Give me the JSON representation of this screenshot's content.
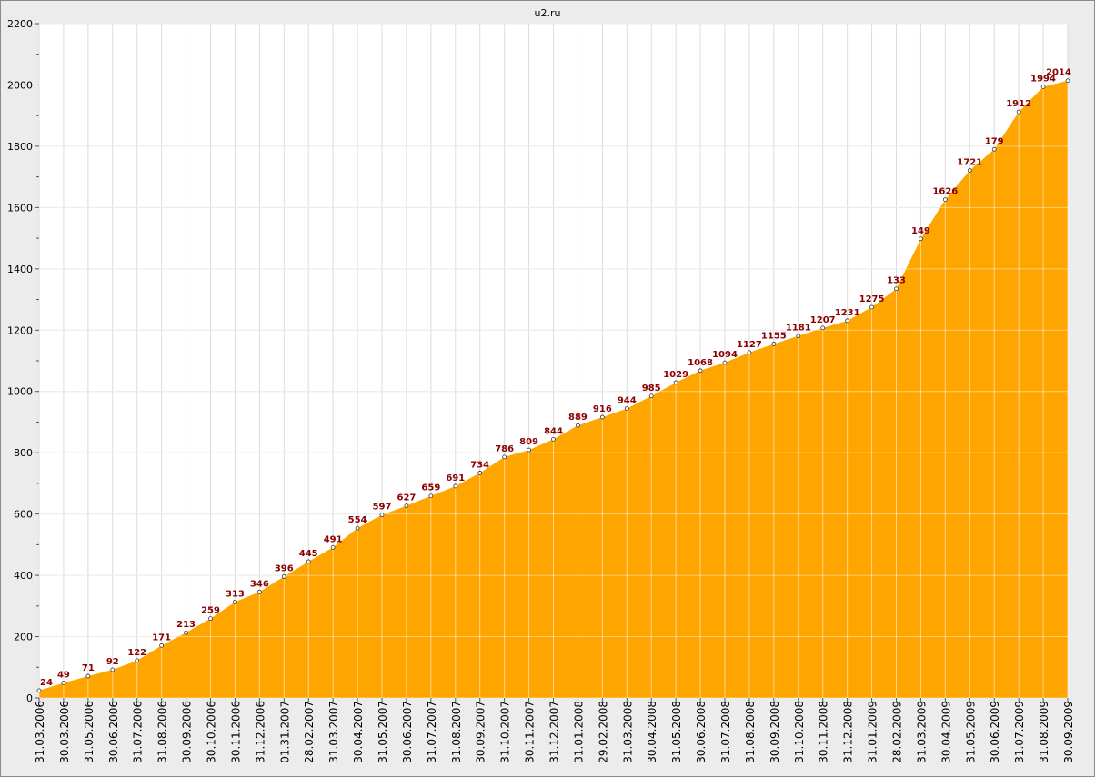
{
  "chart_data": {
    "type": "area",
    "title": "u2.ru",
    "xlabel": "",
    "ylabel": "",
    "ylim": [
      0,
      2200
    ],
    "yticks": [
      0,
      200,
      400,
      600,
      800,
      1000,
      1200,
      1400,
      1600,
      1800,
      2000,
      2200
    ],
    "grid": true,
    "fill_color": "#ffa500",
    "label_color": "#8b0000",
    "categories": [
      "31.03.2006",
      "30.03.2006",
      "31.05.2006",
      "30.06.2006",
      "31.07.2006",
      "31.08.2006",
      "30.09.2006",
      "30.10.2006",
      "30.11.2006",
      "31.12.2006",
      "01.31.2007",
      "28.02.2007",
      "31.03.2007",
      "30.04.2007",
      "31.05.2007",
      "30.06.2007",
      "31.07.2007",
      "31.08.2007",
      "30.09.2007",
      "31.10.2007",
      "30.11.2007",
      "31.12.2007",
      "31.01.2008",
      "29.02.2008",
      "31.03.2008",
      "30.04.2008",
      "31.05.2008",
      "30.06.2008",
      "31.07.2008",
      "31.08.2008",
      "30.09.2008",
      "31.10.2008",
      "30.11.2008",
      "31.12.2008",
      "31.01.2009",
      "28.02.2009",
      "31.03.2009",
      "30.04.2009",
      "31.05.2009",
      "30.06.2009",
      "31.07.2009",
      "31.08.2009",
      "30.09.2009"
    ],
    "values": [
      24,
      49,
      71,
      92,
      122,
      171,
      213,
      259,
      313,
      346,
      396,
      445,
      491,
      554,
      597,
      627,
      659,
      691,
      734,
      786,
      809,
      844,
      889,
      916,
      944,
      985,
      1029,
      1068,
      1094,
      1127,
      1155,
      1181,
      1207,
      1231,
      1275,
      1335,
      1498,
      1626,
      1721,
      1790,
      1912,
      1994,
      2014
    ],
    "labels": [
      "24",
      "49",
      "71",
      "92",
      "122",
      "171",
      "213",
      "259",
      "313",
      "346",
      "396",
      "445",
      "491",
      "554",
      "597",
      "627",
      "659",
      "691",
      "734",
      "786",
      "809",
      "844",
      "889",
      "916",
      "944",
      "985",
      "1029",
      "1068",
      "1094",
      "1127",
      "1155",
      "1181",
      "1207",
      "1231",
      "1275",
      "133",
      "149",
      "1626",
      "1721",
      "179",
      "1912",
      "1994",
      "2014"
    ]
  }
}
